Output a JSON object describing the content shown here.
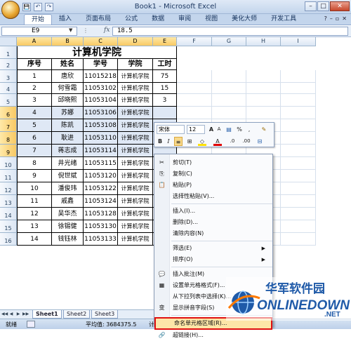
{
  "window": {
    "title": "Book1 - Microsoft Excel"
  },
  "qat": {
    "save": "💾",
    "undo": "↶",
    "redo": "↷"
  },
  "ribbon": {
    "tabs": [
      "开始",
      "插入",
      "页面布局",
      "公式",
      "数据",
      "审阅",
      "视图",
      "美化大师",
      "开发工具"
    ],
    "active_tab": 0
  },
  "formula_bar": {
    "name_box": "E9",
    "fx": "fx",
    "value": "18.5"
  },
  "columns": [
    "A",
    "B",
    "C",
    "D",
    "E",
    "F",
    "G",
    "H",
    "I"
  ],
  "rows": [
    "1",
    "2",
    "3",
    "4",
    "5",
    "6",
    "7",
    "8",
    "9",
    "10",
    "11",
    "12",
    "13",
    "14",
    "15",
    "16"
  ],
  "table": {
    "title": "计算机学院",
    "headers": [
      "序号",
      "姓名",
      "学号",
      "学院",
      "工时"
    ],
    "records": [
      [
        "1",
        "唐欣",
        "11015218",
        "计算机学院",
        "75"
      ],
      [
        "2",
        "何雪霜",
        "11053102",
        "计算机学院",
        "15"
      ],
      [
        "3",
        "邱晓熙",
        "11053104",
        "计算机学院",
        "3"
      ],
      [
        "4",
        "苏娜",
        "11053106",
        "计算机学院",
        ""
      ],
      [
        "5",
        "陈凯",
        "11053108",
        "计算机学院",
        ""
      ],
      [
        "6",
        "耿进",
        "11053110",
        "计算机学院",
        ""
      ],
      [
        "7",
        "蒋志成",
        "11053114",
        "计算机学院",
        ""
      ],
      [
        "8",
        "井光绪",
        "11053115",
        "计算机学院",
        ""
      ],
      [
        "9",
        "倪世斌",
        "11053120",
        "计算机学院",
        ""
      ],
      [
        "10",
        "潘俊玮",
        "11053122",
        "计算机学院",
        ""
      ],
      [
        "11",
        "戚鑫",
        "11053124",
        "计算机学院",
        ""
      ],
      [
        "12",
        "吴华杰",
        "11053128",
        "计算机学院",
        ""
      ],
      [
        "13",
        "徐锡健",
        "11053130",
        "计算机学院",
        ""
      ],
      [
        "14",
        "钱钰林",
        "11053133",
        "计算机学院",
        ""
      ],
      [
        "",
        "",
        "",
        "",
        ""
      ]
    ]
  },
  "mini_toolbar": {
    "font": "宋体",
    "size": "12",
    "grow": "A",
    "shrink": "A",
    "percent": "%",
    "comma": ",",
    "bold": "B",
    "italic": "I",
    "align": "≡",
    "fill_label": "A",
    "font_color": "A",
    "inc_decimal": ".0",
    "dec_decimal": ".00"
  },
  "context_menu": {
    "items": [
      {
        "label": "剪切(T)",
        "icon": "✂"
      },
      {
        "label": "复制(C)",
        "icon": "⎘"
      },
      {
        "label": "粘贴(P)",
        "icon": "📋"
      },
      {
        "label": "选择性粘贴(V)...",
        "icon": ""
      },
      {
        "label": "插入(I)...",
        "icon": ""
      },
      {
        "label": "删除(D)...",
        "icon": ""
      },
      {
        "label": "清除内容(N)",
        "icon": ""
      },
      {
        "label": "筛选(E)",
        "icon": "",
        "submenu": true
      },
      {
        "label": "排序(O)",
        "icon": "",
        "submenu": true
      },
      {
        "label": "插入批注(M)",
        "icon": "💬"
      },
      {
        "label": "设置单元格格式(F)...",
        "icon": "▦"
      },
      {
        "label": "从下拉列表中选择(K)...",
        "icon": ""
      },
      {
        "label": "显示拼音字段(S)",
        "icon": "变"
      },
      {
        "label": "命名单元格区域(R)...",
        "icon": ""
      },
      {
        "label": "超链接(H)...",
        "icon": "🔗"
      }
    ]
  },
  "sheet_tabs": [
    "Sheet1",
    "Sheet2",
    "Sheet3"
  ],
  "status": {
    "mode": "就绪",
    "average": "平均值: 3684375.5",
    "count_prefix": "计"
  },
  "watermark": {
    "cn": "华军软件园",
    "en": "ONLINEDOWN",
    "tld": ".NET"
  },
  "colors": {
    "accent": "#1f5aa8",
    "highlight_border": "#e01010",
    "selection": "#dfe8f5"
  }
}
